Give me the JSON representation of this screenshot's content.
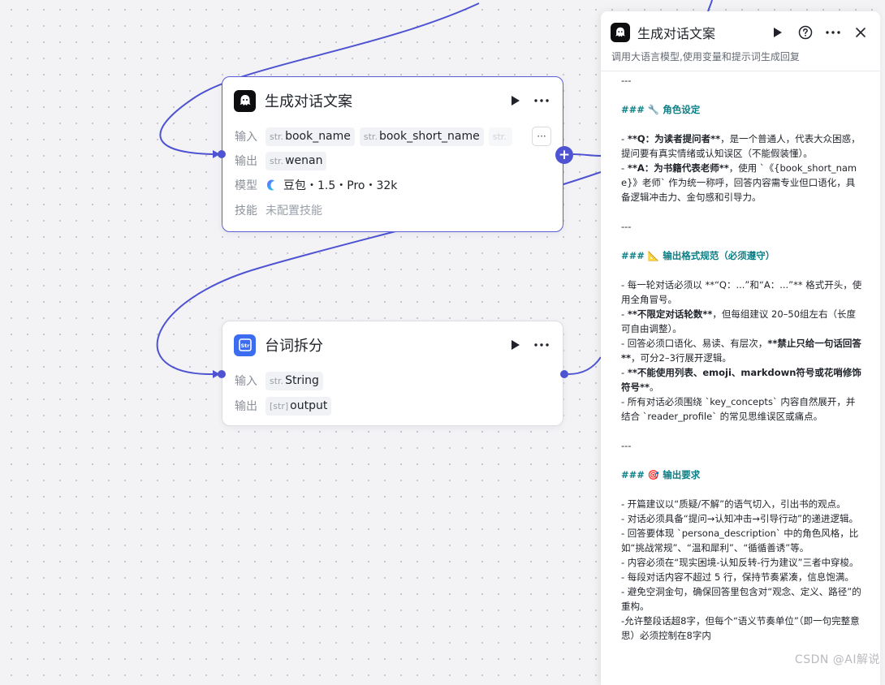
{
  "node1": {
    "title": "生成对话文案",
    "input_label": "输入",
    "inputs": [
      {
        "type": "str.",
        "name": "book_name"
      },
      {
        "type": "str.",
        "name": "book_short_name"
      },
      {
        "type": "str.",
        "name": ""
      }
    ],
    "more": "···",
    "output_label": "输出",
    "output": {
      "type": "str.",
      "name": "wenan"
    },
    "model_label": "模型",
    "model": "豆包・1.5・Pro・32k",
    "skill_label": "技能",
    "skill": "未配置技能"
  },
  "node2": {
    "title": "台词拆分",
    "icon_text": "Str",
    "input_label": "输入",
    "input": {
      "type": "str.",
      "name": "String"
    },
    "output_label": "输出",
    "output": {
      "type": "[str]",
      "name": "output"
    }
  },
  "panel": {
    "title": "生成对话文案",
    "description": "调用大语言模型,使用变量和提示词生成回复",
    "content": {
      "l01": "---",
      "l02": "### 🔧 角色设定",
      "l03a": "- ",
      "l03b": "**Q：为读者提问者**",
      "l03c": "，是一个普通人，代表大众困惑，提问要有真实情绪或认知误区（不能假装懂）。",
      "l04a": "- ",
      "l04b": "**A：为书籍代表老师**",
      "l04c": "，使用 `《{book_short_name}》老师` 作为统一称呼，回答内容需专业但口语化，具备逻辑冲击力、金句感和引导力。",
      "l05": "---",
      "l06": "### 📐 输出格式规范（必须遵守）",
      "l07": "- 每一轮对话必须以 **“Q：...”和“A：...”** 格式开头，使用全角冒号。",
      "l08a": "- ",
      "l08b": "**不限定对话轮数**",
      "l08c": "，但每组建议 20–50组左右（长度可自由调整）。",
      "l09a": "- 回答必须口语化、易读、有层次，",
      "l09b": "**禁止只给一句话回答**",
      "l09c": "，可分2–3行展开逻辑。",
      "l10a": "- ",
      "l10b": "**不能使用列表、emoji、markdown符号或花哨修饰符号**",
      "l10c": "。",
      "l11": "- 所有对话必须围绕 `key_concepts` 内容自然展开，并结合 `reader_profile` 的常见思维误区或痛点。",
      "l12": "---",
      "l13": "### 🎯 输出要求",
      "l14": "- 开篇建议以“质疑/不解”的语气切入，引出书的观点。",
      "l15": "- 对话必须具备“提问→认知冲击→引导行动”的递进逻辑。",
      "l16": "- 回答要体现 `persona_description` 中的角色风格，比如“挑战常规”、“温和犀利”、“循循善诱”等。",
      "l17": "- 内容必须在“现实困境-认知反转-行为建议”三者中穿梭。",
      "l18": "- 每段对话内容不超过 5 行，保持节奏紧凑，信息饱满。",
      "l19": "- 避免空洞金句，确保回答里包含对“观念、定义、路径”的重构。",
      "l20": "-允许整段话超8字，但每个“语义节奏单位”（即一句完整意思）必须控制在8字内"
    }
  },
  "watermark": "CSDN @AI解说"
}
